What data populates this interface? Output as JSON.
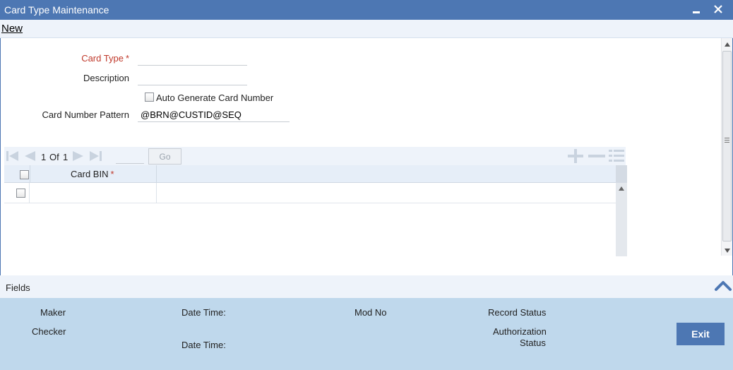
{
  "window": {
    "title": "Card Type Maintenance"
  },
  "toolbar": {
    "new_label": "New"
  },
  "form": {
    "card_type_label": "Card Type",
    "card_type_value": "",
    "required_marker": "*",
    "description_label": "Description",
    "description_value": "",
    "auto_generate_label": "Auto Generate Card Number",
    "auto_generate_checked": false,
    "pattern_label": "Card Number Pattern",
    "pattern_value": "@BRN@CUSTID@SEQ"
  },
  "grid": {
    "pager": {
      "current": "1",
      "of_label": "Of",
      "total": "1",
      "go_label": "Go"
    },
    "columns": [
      {
        "label": "Card BIN",
        "required_marker": "*"
      }
    ],
    "rows": [
      {
        "card_bin": "",
        "checked": false
      }
    ]
  },
  "fields_bar": {
    "label": "Fields"
  },
  "audit": {
    "maker_label": "Maker",
    "checker_label": "Checker",
    "date_time_label_1": "Date Time:",
    "date_time_label_2": "Date Time:",
    "mod_no_label": "Mod No",
    "record_status_label": "Record Status",
    "authorization_label_line1": "Authorization",
    "authorization_label_line2": "Status",
    "exit_label": "Exit"
  },
  "colors": {
    "title_bar": "#4d77b3",
    "required": "#c0392b",
    "audit_panel": "#bfd8ec"
  }
}
